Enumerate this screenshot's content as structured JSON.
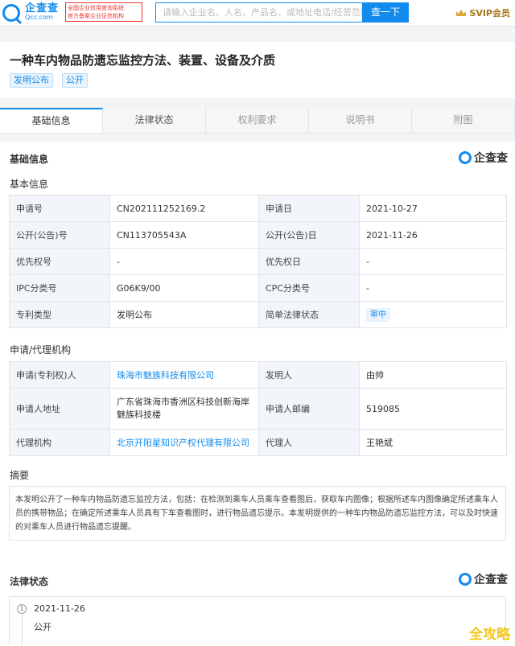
{
  "header": {
    "logo_cn": "企查查",
    "logo_en": "Qcc.com",
    "badge_line1": "全国企业信用查询系统",
    "badge_line2": "官方备案企业征信机构",
    "search_placeholder": "请输入企业名、人名、产品名、或地址电话/经营范围",
    "search_button": "查一下",
    "vip_label": "SVIP会员",
    "brand_color": "#128bed"
  },
  "title_card": {
    "title": "一种车内物品防遗忘监控方法、装置、设备及介质",
    "tags": [
      "发明公布",
      "公开"
    ]
  },
  "tabs": [
    {
      "label": "基础信息",
      "active": true
    },
    {
      "label": "法律状态",
      "active": false
    },
    {
      "label": "权利要求",
      "active": false
    },
    {
      "label": "说明书",
      "active": false
    },
    {
      "label": "附图",
      "active": false
    }
  ],
  "basic": {
    "section_title": "基础信息",
    "qcc_mark": "企查查",
    "subsection": "基本信息",
    "rows": [
      {
        "l1": "申请号",
        "v1": "CN202111252169.2",
        "l2": "申请日",
        "v2": "2021-10-27"
      },
      {
        "l1": "公开(公告)号",
        "v1": "CN113705543A",
        "l2": "公开(公告)日",
        "v2": "2021-11-26"
      },
      {
        "l1": "优先权号",
        "v1": "-",
        "l2": "优先权日",
        "v2": "-"
      },
      {
        "l1": "IPC分类号",
        "v1": "G06K9/00",
        "l2": "CPC分类号",
        "v2": "-"
      },
      {
        "l1": "专利类型",
        "v1": "发明公布",
        "l2": "简单法律状态",
        "v2": "审中"
      }
    ]
  },
  "applicant": {
    "subsection": "申请/代理机构",
    "rows": [
      {
        "l1": "申请(专利权)人",
        "v1": "珠海市魅族科技有限公司",
        "l2": "发明人",
        "v2": "由帅"
      },
      {
        "l1": "申请人地址",
        "v1": "广东省珠海市香洲区科技创新海岸魅族科技楼",
        "l2": "申请人邮编",
        "v2": "519085"
      },
      {
        "l1": "代理机构",
        "v1": "北京开阳星知识产权代理有限公司",
        "l2": "代理人",
        "v2": "王艳斌"
      }
    ]
  },
  "abstract": {
    "title": "摘要",
    "text": "本发明公开了一种车内物品防遗忘监控方法，包括：在检测到乘车人员乘车查看图后，获取车内图像；根据所述车内图像确定所述乘车人员的携带物品；在确定所述乘车人员具有下车查看图时，进行物品遗忘提示。本发明提供的一种车内物品防遗忘监控方法，可以及时快速的对乘车人员进行物品遗忘提醒。"
  },
  "legal": {
    "section_title": "法律状态",
    "qcc_mark": "企查查",
    "items": [
      {
        "num": "1",
        "date": "2021-11-26",
        "desc": "公开"
      }
    ]
  },
  "watermark": "全攻略"
}
